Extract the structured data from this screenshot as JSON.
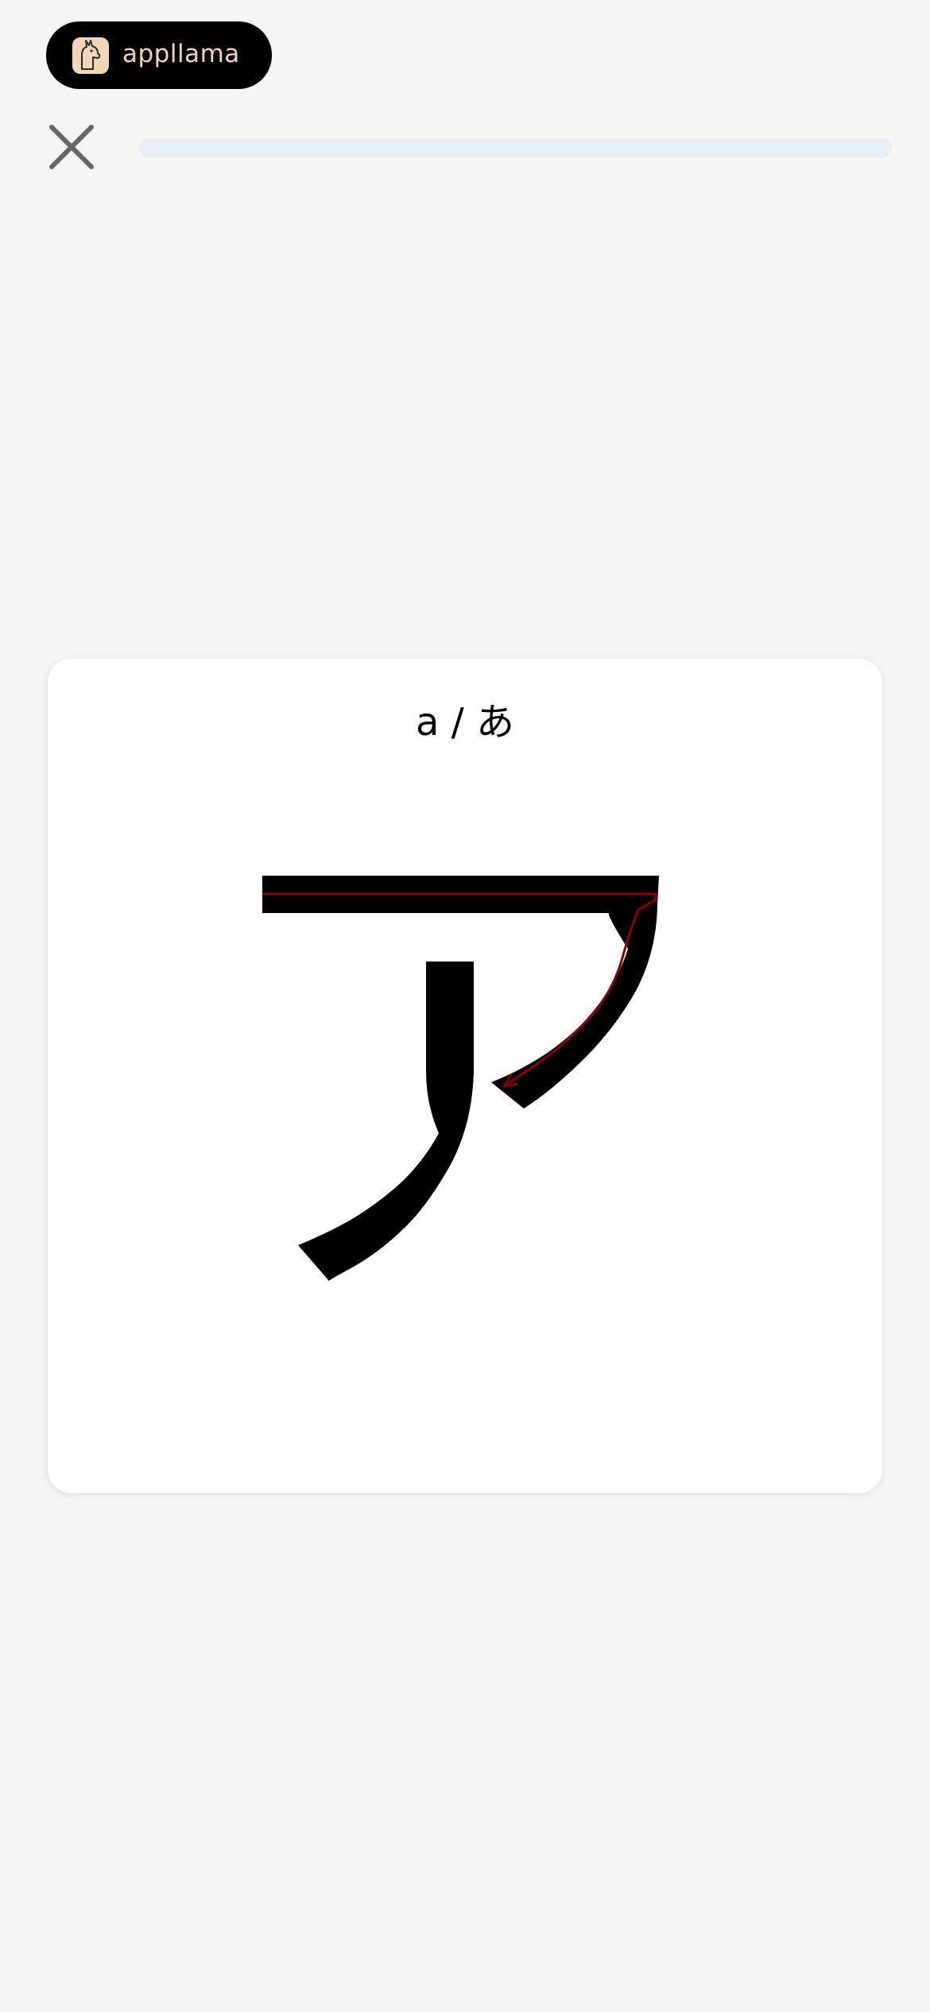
{
  "brand": {
    "name": "appllama",
    "logo_icon": "llama-icon",
    "color": "#f3d6b9"
  },
  "toolbar": {
    "close_icon": "close-icon"
  },
  "progress": {
    "value": 0,
    "track_color": "#e8eef6"
  },
  "card": {
    "label": "a / あ",
    "character": "ア",
    "stroke_arrow_color": "#8b0000"
  }
}
